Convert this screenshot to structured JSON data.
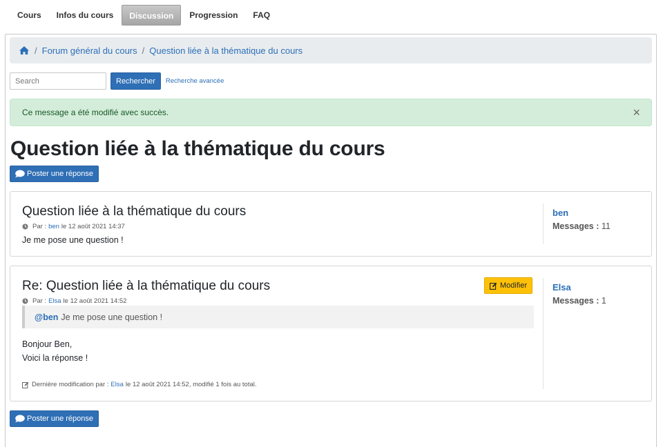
{
  "tabs": [
    {
      "label": "Cours",
      "active": false
    },
    {
      "label": "Infos du cours",
      "active": false
    },
    {
      "label": "Discussion",
      "active": true
    },
    {
      "label": "Progression",
      "active": false
    },
    {
      "label": "FAQ",
      "active": false
    }
  ],
  "breadcrumb": {
    "home_icon": "home-icon",
    "items": [
      "Forum général du cours",
      "Question liée à la thématique du cours"
    ],
    "separator": "/"
  },
  "search": {
    "placeholder": "Search",
    "button_label": "Rechercher",
    "advanced_label": "Recherche avancée"
  },
  "alert": {
    "message": "Ce message a été modifié avec succès.",
    "close": "×"
  },
  "page_title": "Question liée à la thématique du cours",
  "reply_button": "Poster une réponse",
  "posts": [
    {
      "title": "Question liée à la thématique du cours",
      "meta_prefix": "Par :",
      "author": "ben",
      "meta_date": "le 12 août 2021 14:37",
      "body_lines": [
        "Je me pose une question !"
      ],
      "sidebar_author": "ben",
      "messages_label": "Messages :",
      "messages_count": "11"
    },
    {
      "title": "Re: Question liée à la thématique du cours",
      "edit_label": "Modifier",
      "meta_prefix": "Par :",
      "author": "Elsa",
      "meta_date": "le 12 août 2021 14:52",
      "quote_mention": "@ben",
      "quote_text": "Je me pose une question !",
      "body_lines": [
        "Bonjour Ben,",
        "Voici la réponse !"
      ],
      "last_mod_prefix": "Dernière modification par :",
      "last_mod_author": "Elsa",
      "last_mod_suffix": "le 12 août 2021 14:52, modifié 1 fois au total.",
      "sidebar_author": "Elsa",
      "messages_label": "Messages :",
      "messages_count": "1"
    }
  ],
  "colors": {
    "link": "#2a6fb7",
    "primary": "#2f6fb5",
    "warning": "#ffc107",
    "success_bg": "#d4edda",
    "success_text": "#155724"
  }
}
